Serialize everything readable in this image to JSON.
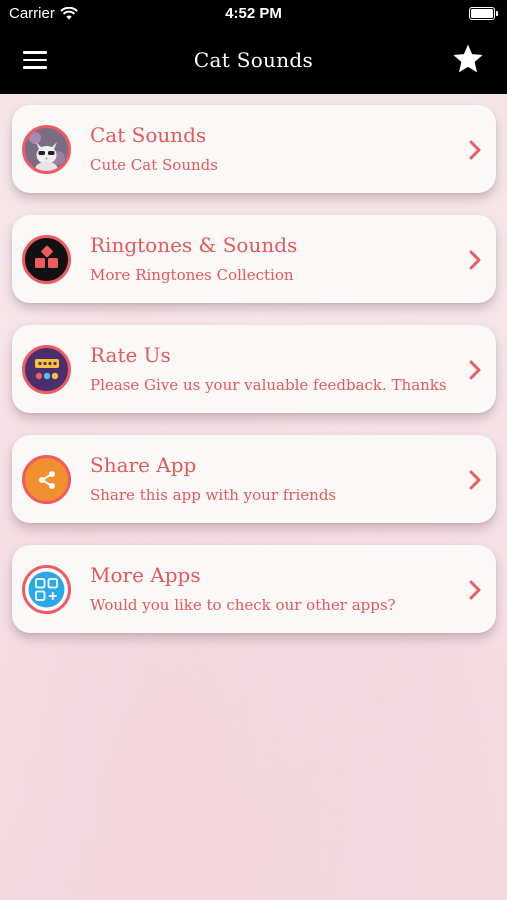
{
  "status_bar": {
    "carrier": "Carrier",
    "time": "4:52 PM"
  },
  "nav": {
    "title": "Cat Sounds"
  },
  "menu": [
    {
      "title": "Cat Sounds",
      "subtitle": "Cute Cat Sounds"
    },
    {
      "title": "Ringtones & Sounds",
      "subtitle": "More Ringtones Collection"
    },
    {
      "title": "Rate Us",
      "subtitle": "Please Give us your valuable feedback. Thanks"
    },
    {
      "title": "Share App",
      "subtitle": "Share this app with your friends"
    },
    {
      "title": "More Apps",
      "subtitle": "Would you like to check our other apps?"
    }
  ],
  "colors": {
    "accent": "#e5585b",
    "navbar": "#000000",
    "card": "#fbf8f8"
  }
}
